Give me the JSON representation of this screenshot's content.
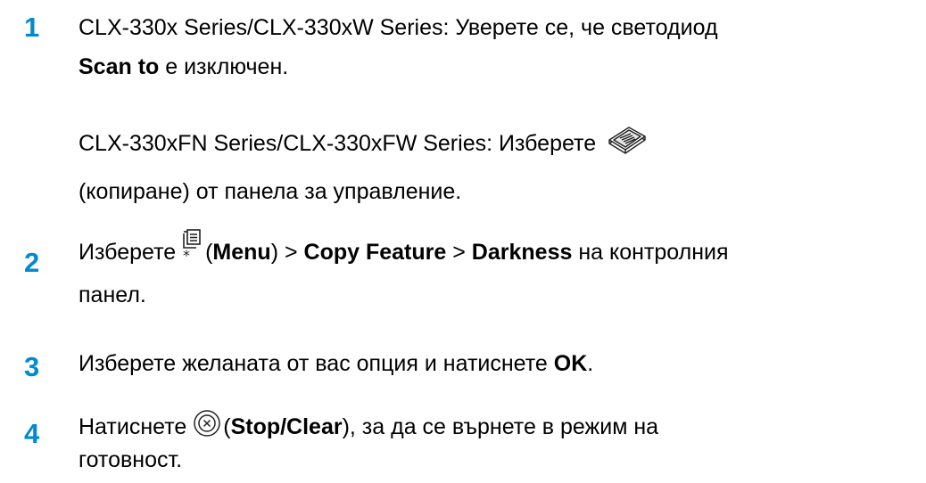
{
  "steps": [
    {
      "number": "1",
      "line1": {
        "text": "CLX-330x Series/CLX-330xW Series: Уверете се, че светодиод"
      },
      "line2": {
        "bold": "Scan to",
        "after": " е изключен."
      },
      "line3": {
        "text": "CLX-330xFN Series/CLX-330xFW Series: Изберете ",
        "icon": "copy-icon"
      },
      "line4": {
        "text": "(копиране) от панела за управление."
      }
    },
    {
      "number": "2",
      "line1": {
        "before": "Изберете ",
        "icon": "menu-icon",
        "paren_open": "(",
        "menu": "Menu",
        "sep1": ") > ",
        "copy_feature": "Copy Feature",
        "sep2": " > ",
        "darkness": "Darkness",
        "after": " на контролния"
      },
      "line2": {
        "text": "панел."
      }
    },
    {
      "number": "3",
      "line1": {
        "before": "Изберете желаната от вас опция и натиснете ",
        "ok": "OK",
        "after": "."
      }
    },
    {
      "number": "4",
      "line1": {
        "before": "Натиснете ",
        "icon": "stop-clear-icon",
        "paren_open": "(",
        "stop": "Stop/Clear",
        "after": "), за да се върнете в режим на"
      },
      "line2": {
        "text": "готовност."
      }
    }
  ],
  "colors": {
    "step_number": "#008bd0",
    "text": "#000000"
  }
}
